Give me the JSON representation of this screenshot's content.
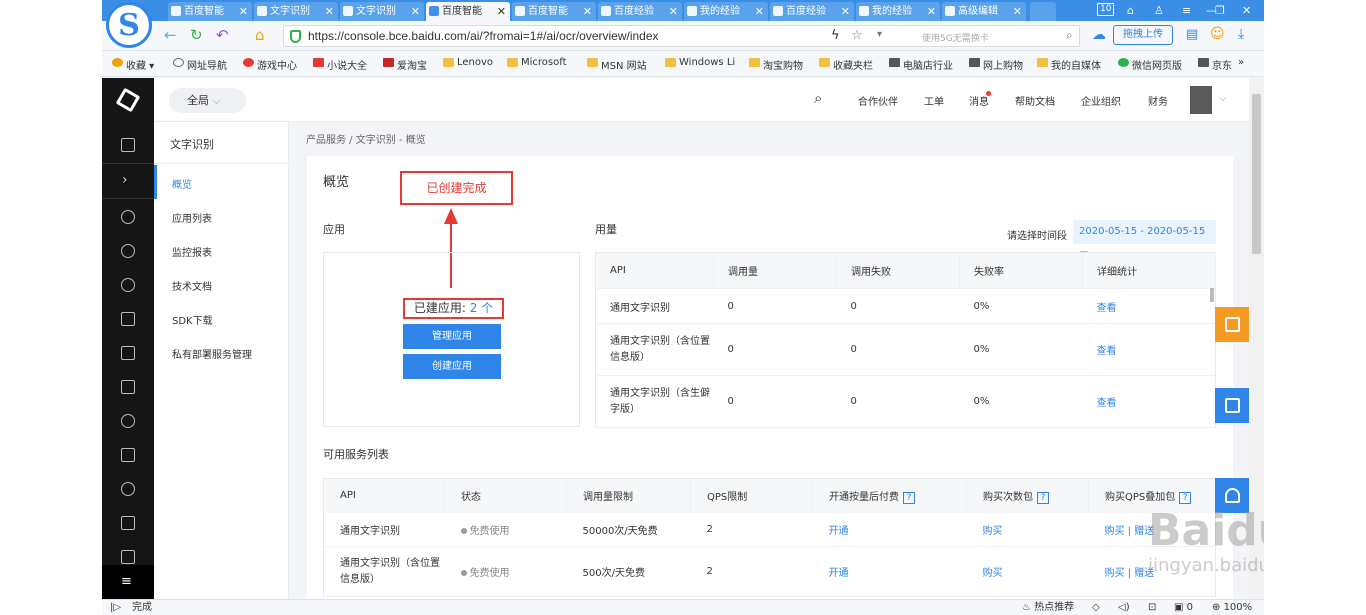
{
  "browser": {
    "tabs": [
      "百度智能",
      "文字识别",
      "文字识别",
      "百度智能",
      "百度智能",
      "百度经验",
      "我的经验",
      "百度经验",
      "我的经验",
      "高级编辑"
    ],
    "win_badge": "10",
    "url": "https://console.bce.baidu.com/ai/?fromai=1#/ai/ocr/overview/index",
    "search_placeholder": "使用5G无需换卡",
    "upload_label": "拖拽上传",
    "bookmarks": [
      "收藏",
      "网址导航",
      "游戏中心",
      "小说大全",
      "爱淘宝",
      "Lenovo",
      "Microsoft",
      "MSN 网站",
      "Windows Li",
      "淘宝购物",
      "收藏夹栏",
      "电脑店行业",
      "网上购物",
      "我的自媒体",
      "微信网页版",
      "京东"
    ],
    "status": "完成",
    "status_right": [
      "热点推荐",
      "0",
      "100%"
    ]
  },
  "header": {
    "region": "全局",
    "nav": [
      "合作伙伴",
      "工单",
      "消息",
      "帮助文档",
      "企业组织",
      "财务"
    ]
  },
  "submenu": {
    "title": "文字识别",
    "items": [
      "概览",
      "应用列表",
      "监控报表",
      "技术文档",
      "SDK下载",
      "私有部署服务管理"
    ]
  },
  "breadcrumb": "产品服务 / 文字识别 - 概览",
  "overview": {
    "title": "概览",
    "annotation": "已创建完成",
    "app_section": "应用",
    "created_label": "已建应用:",
    "created_count": "2 个",
    "manage_btn": "管理应用",
    "create_btn": "创建应用",
    "usage_section": "用量",
    "date_label": "请选择时间段",
    "date_range": "2020-05-15 - 2020-05-15",
    "usage_headers": [
      "API",
      "调用量",
      "调用失败",
      "失败率",
      "详细统计"
    ],
    "usage_rows": [
      [
        "通用文字识别",
        "0",
        "0",
        "0%",
        "查看"
      ],
      [
        "通用文字识别（含位置信息版）",
        "0",
        "0",
        "0%",
        "查看"
      ],
      [
        "通用文字识别（含生僻字版）",
        "0",
        "0",
        "0%",
        "查看"
      ]
    ]
  },
  "services": {
    "title": "可用服务列表",
    "headers": [
      "API",
      "状态",
      "调用量限制",
      "QPS限制",
      "开通按量后付费",
      "购买次数包",
      "购买QPS叠加包"
    ],
    "rows": [
      [
        "通用文字识别",
        "免费使用",
        "50000次/天免费",
        "2",
        "开通",
        "购买",
        "购买 | 赠送"
      ],
      [
        "通用文字识别（含位置信息版）",
        "免费使用",
        "500次/天免费",
        "2",
        "开通",
        "购买",
        "购买 | 赠送"
      ]
    ]
  },
  "watermark": {
    "main": "Baidu 经验",
    "sub": "jingyan.baidu.com"
  },
  "colors": {
    "accent": "#2f86e8",
    "annotation": "#e53935",
    "rail": "#151515",
    "float_orange": "#f59a23"
  }
}
